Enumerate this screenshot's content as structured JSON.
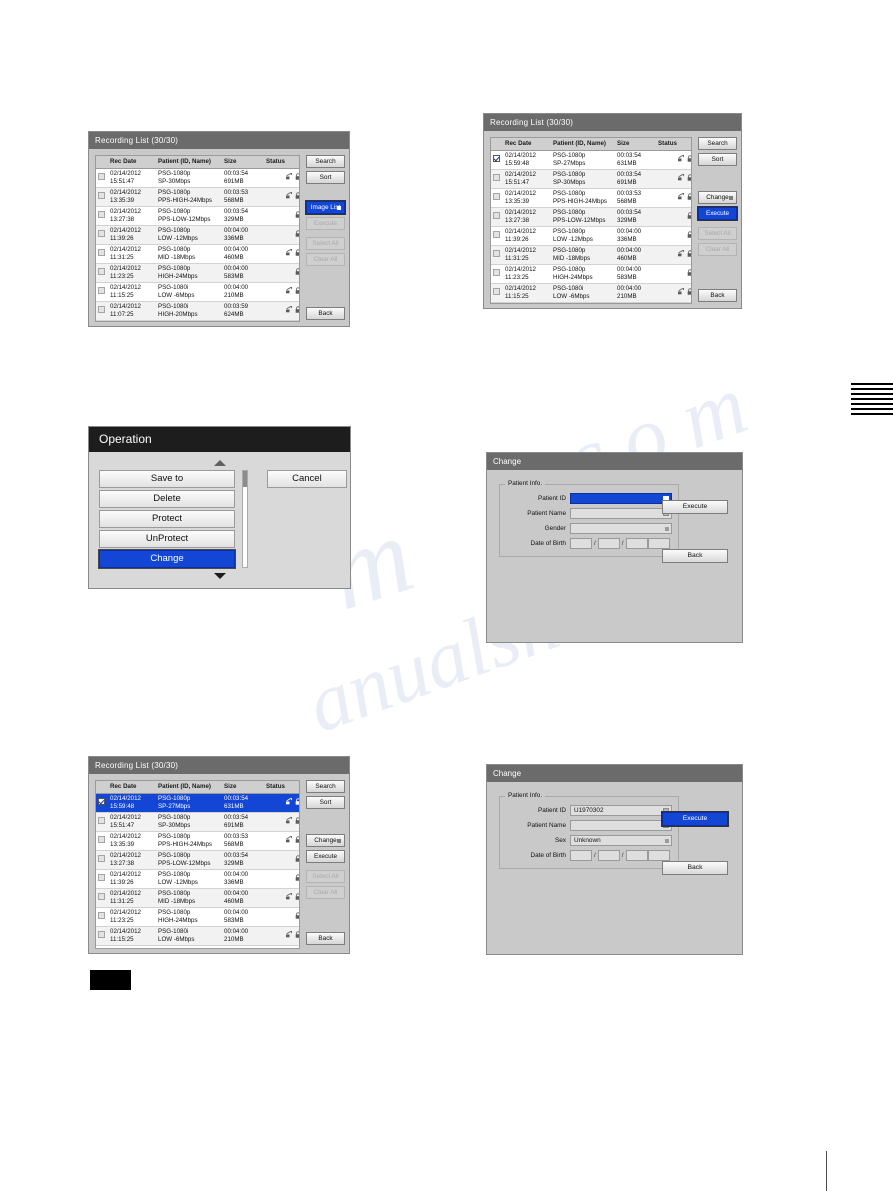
{
  "page": {
    "background": "#ffffff",
    "accent_blue": "#1446d6",
    "title_bar_gray": "#6b6b6b",
    "panel_gray": "#c9c9c9",
    "watermark_text": "manualshive.com"
  },
  "common": {
    "columns": [
      "Rec Date",
      "Patient (ID, Name)",
      "Size",
      "Status"
    ],
    "side_buttons": {
      "search": "Search",
      "sort": "Sort",
      "image_list": "Image List",
      "change": "Change",
      "execute": "Execute",
      "select_all": "Select All",
      "clear_all": "Clear All",
      "back": "Back"
    },
    "icons": {
      "network": "network-share-icon",
      "lock": "lock-icon",
      "checkbox": "checkbox-icon",
      "keyboard": "keyboard-icon",
      "dropdown": "dropdown-icon"
    }
  },
  "panel_top_left": {
    "title": "Recording List  (30/30)",
    "rows": [
      {
        "date": "02/14/2012",
        "time": "15:51:47",
        "patient_id": "PSG-1080p",
        "patient_name": "SP-30Mbps",
        "duration": "00:03:54",
        "size": "691MB",
        "network": true,
        "locked": true,
        "checked": false,
        "selected": false
      },
      {
        "date": "02/14/2012",
        "time": "13:35:39",
        "patient_id": "PSG-1080p",
        "patient_name": "PPS-HIGH-24Mbps",
        "duration": "00:03:53",
        "size": "568MB",
        "network": true,
        "locked": true,
        "checked": false,
        "selected": false
      },
      {
        "date": "02/14/2012",
        "time": "13:27:38",
        "patient_id": "PSG-1080p",
        "patient_name": "PPS-LOW-12Mbps",
        "duration": "00:03:54",
        "size": "329MB",
        "network": false,
        "locked": true,
        "checked": false,
        "selected": false
      },
      {
        "date": "02/14/2012",
        "time": "11:39:26",
        "patient_id": "PSG-1080p",
        "patient_name": "LOW -12Mbps",
        "duration": "00:04:00",
        "size": "336MB",
        "network": false,
        "locked": true,
        "checked": false,
        "selected": false
      },
      {
        "date": "02/14/2012",
        "time": "11:31:25",
        "patient_id": "PSG-1080p",
        "patient_name": "MID -18Mbps",
        "duration": "00:04:00",
        "size": "460MB",
        "network": true,
        "locked": true,
        "checked": false,
        "selected": false
      },
      {
        "date": "02/14/2012",
        "time": "11:23:25",
        "patient_id": "PSG-1080p",
        "patient_name": "HIGH-24Mbps",
        "duration": "00:04:00",
        "size": "583MB",
        "network": false,
        "locked": true,
        "checked": false,
        "selected": false
      },
      {
        "date": "02/14/2012",
        "time": "11:15:25",
        "patient_id": "PSG-1080i",
        "patient_name": "LOW -6Mbps",
        "duration": "00:04:00",
        "size": "210MB",
        "network": true,
        "locked": true,
        "checked": false,
        "selected": false
      },
      {
        "date": "02/14/2012",
        "time": "11:07:25",
        "patient_id": "PSG-1080i",
        "patient_name": "HIGH-20Mbps",
        "duration": "00:03:59",
        "size": "624MB",
        "network": true,
        "locked": true,
        "checked": false,
        "selected": false
      }
    ],
    "buttons": {
      "search": "Search",
      "sort": "Sort",
      "image_list": "Image List",
      "execute": "Execute",
      "select_all": "Select All",
      "clear_all": "Clear All",
      "back": "Back"
    },
    "highlighted_button": "Image List",
    "disabled_buttons": [
      "Execute",
      "Select All",
      "Clear All"
    ]
  },
  "panel_top_right": {
    "title": "Recording List  (30/30)",
    "rows": [
      {
        "date": "02/14/2012",
        "time": "15:59:48",
        "patient_id": "PSG-1080p",
        "patient_name": "SP-27Mbps",
        "duration": "00:03:54",
        "size": "631MB",
        "network": true,
        "locked": true,
        "checked": true,
        "selected": false
      },
      {
        "date": "02/14/2012",
        "time": "15:51:47",
        "patient_id": "PSG-1080p",
        "patient_name": "SP-30Mbps",
        "duration": "00:03:54",
        "size": "691MB",
        "network": true,
        "locked": true,
        "checked": false,
        "selected": false
      },
      {
        "date": "02/14/2012",
        "time": "13:35:39",
        "patient_id": "PSG-1080p",
        "patient_name": "PPS-HIGH-24Mbps",
        "duration": "00:03:53",
        "size": "568MB",
        "network": true,
        "locked": true,
        "checked": false,
        "selected": false
      },
      {
        "date": "02/14/2012",
        "time": "13:27:38",
        "patient_id": "PSG-1080p",
        "patient_name": "PPS-LOW-12Mbps",
        "duration": "00:03:54",
        "size": "329MB",
        "network": false,
        "locked": true,
        "checked": false,
        "selected": false
      },
      {
        "date": "02/14/2012",
        "time": "11:39:26",
        "patient_id": "PSG-1080p",
        "patient_name": "LOW -12Mbps",
        "duration": "00:04:00",
        "size": "336MB",
        "network": false,
        "locked": true,
        "checked": false,
        "selected": false
      },
      {
        "date": "02/14/2012",
        "time": "11:31:25",
        "patient_id": "PSG-1080p",
        "patient_name": "MID -18Mbps",
        "duration": "00:04:00",
        "size": "460MB",
        "network": true,
        "locked": true,
        "checked": false,
        "selected": false
      },
      {
        "date": "02/14/2012",
        "time": "11:23:25",
        "patient_id": "PSG-1080p",
        "patient_name": "HIGH-24Mbps",
        "duration": "00:04:00",
        "size": "583MB",
        "network": false,
        "locked": true,
        "checked": false,
        "selected": false
      },
      {
        "date": "02/14/2012",
        "time": "11:15:25",
        "patient_id": "PSG-1080i",
        "patient_name": "LOW -6Mbps",
        "duration": "00:04:00",
        "size": "210MB",
        "network": true,
        "locked": true,
        "checked": false,
        "selected": false
      }
    ],
    "buttons": {
      "search": "Search",
      "sort": "Sort",
      "change": "Change",
      "execute": "Execute",
      "select_all": "Select All",
      "clear_all": "Clear All",
      "back": "Back"
    },
    "highlighted_button": "Execute",
    "disabled_buttons": [
      "Select All",
      "Clear All"
    ]
  },
  "panel_bottom_left": {
    "title": "Recording List  (30/30)",
    "rows": [
      {
        "date": "02/14/2012",
        "time": "15:59:48",
        "patient_id": "PSG-1080p",
        "patient_name": "SP-27Mbps",
        "duration": "00:03:54",
        "size": "631MB",
        "network": true,
        "locked": true,
        "checked": true,
        "selected": true
      },
      {
        "date": "02/14/2012",
        "time": "15:51:47",
        "patient_id": "PSG-1080p",
        "patient_name": "SP-30Mbps",
        "duration": "00:03:54",
        "size": "691MB",
        "network": true,
        "locked": true,
        "checked": false,
        "selected": false
      },
      {
        "date": "02/14/2012",
        "time": "13:35:39",
        "patient_id": "PSG-1080p",
        "patient_name": "PPS-HIGH-24Mbps",
        "duration": "00:03:53",
        "size": "568MB",
        "network": true,
        "locked": true,
        "checked": false,
        "selected": false
      },
      {
        "date": "02/14/2012",
        "time": "13:27:38",
        "patient_id": "PSG-1080p",
        "patient_name": "PPS-LOW-12Mbps",
        "duration": "00:03:54",
        "size": "329MB",
        "network": false,
        "locked": true,
        "checked": false,
        "selected": false
      },
      {
        "date": "02/14/2012",
        "time": "11:39:26",
        "patient_id": "PSG-1080p",
        "patient_name": "LOW -12Mbps",
        "duration": "00:04:00",
        "size": "336MB",
        "network": false,
        "locked": true,
        "checked": false,
        "selected": false
      },
      {
        "date": "02/14/2012",
        "time": "11:31:25",
        "patient_id": "PSG-1080p",
        "patient_name": "MID -18Mbps",
        "duration": "00:04:00",
        "size": "460MB",
        "network": true,
        "locked": true,
        "checked": false,
        "selected": false
      },
      {
        "date": "02/14/2012",
        "time": "11:23:25",
        "patient_id": "PSG-1080p",
        "patient_name": "HIGH-24Mbps",
        "duration": "00:04:00",
        "size": "583MB",
        "network": false,
        "locked": true,
        "checked": false,
        "selected": false
      },
      {
        "date": "02/14/2012",
        "time": "11:15:25",
        "patient_id": "PSG-1080i",
        "patient_name": "LOW -6Mbps",
        "duration": "00:04:00",
        "size": "210MB",
        "network": true,
        "locked": true,
        "checked": false,
        "selected": false
      }
    ],
    "buttons": {
      "search": "Search",
      "sort": "Sort",
      "change": "Change",
      "execute": "Execute",
      "select_all": "Select All",
      "clear_all": "Clear All",
      "back": "Back"
    },
    "highlighted_button": "",
    "disabled_buttons": [
      "Select All",
      "Clear All"
    ]
  },
  "operation_dialog": {
    "title": "Operation",
    "items": [
      {
        "label": "Save to",
        "selected": false
      },
      {
        "label": "Delete",
        "selected": false
      },
      {
        "label": "Protect",
        "selected": false
      },
      {
        "label": "UnProtect",
        "selected": false
      },
      {
        "label": "Change",
        "selected": true
      }
    ],
    "cancel_label": "Cancel",
    "scroll_up_icon": "triangle-up-icon",
    "scroll_down_icon": "triangle-down-icon"
  },
  "change_dialog_mid": {
    "title": "Change",
    "group_label": "Patient Info.",
    "fields": [
      {
        "label": "Patient ID",
        "value": "",
        "active": true
      },
      {
        "label": "Patient Name",
        "value": "",
        "active": false
      },
      {
        "label": "Gender",
        "value": "",
        "active": false
      }
    ],
    "dob_label": "Date of Birth",
    "dob_parts": [
      "",
      "",
      "",
      ""
    ],
    "dob_separator": "/",
    "execute_label": "Execute",
    "back_label": "Back",
    "highlighted_button": ""
  },
  "change_dialog_bottom": {
    "title": "Change",
    "group_label": "Patient Info.",
    "fields": [
      {
        "label": "Patient ID",
        "value": "U1970302",
        "active": false
      },
      {
        "label": "Patient Name",
        "value": "",
        "active": false
      },
      {
        "label": "Sex",
        "value": "Unknown",
        "active": false
      }
    ],
    "dob_label": "Date of Birth",
    "dob_parts": [
      "",
      "",
      "",
      ""
    ],
    "dob_separator": "/",
    "execute_label": "Execute",
    "back_label": "Back",
    "highlighted_button": "Execute"
  },
  "page_marks": {
    "redaction_note": "redacted-black-block",
    "edge_tab_lines": 7
  }
}
